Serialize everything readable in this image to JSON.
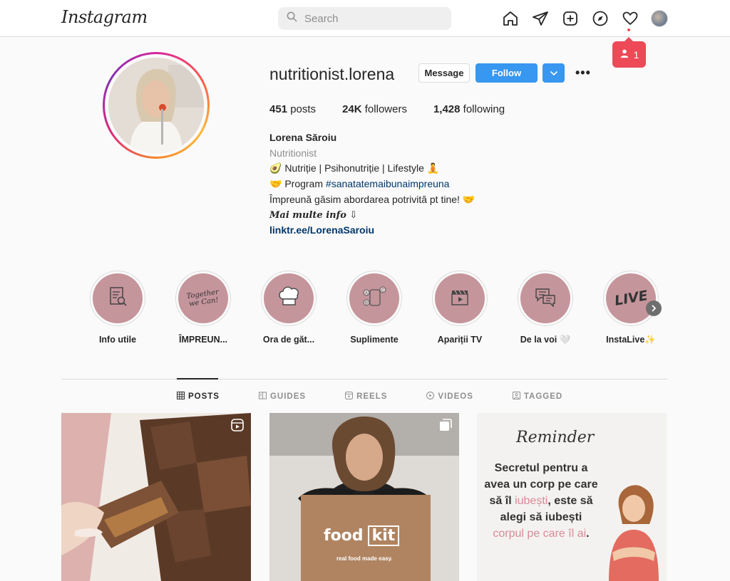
{
  "nav": {
    "logo": "Instagram",
    "search_placeholder": "Search",
    "notifications_count": "1"
  },
  "profile": {
    "username": "nutritionist.lorena",
    "message_label": "Message",
    "follow_label": "Follow",
    "more_label": "•••",
    "stats": {
      "posts_count": "451",
      "posts_label": "posts",
      "followers_count": "24K",
      "followers_label": "followers",
      "following_count": "1,428",
      "following_label": "following"
    },
    "bio": {
      "name": "Lorena Săroiu",
      "category": "Nutritionist",
      "line1": "🥑 Nutriție | Psihonutriție | Lifestyle 🧘",
      "line2_prefix": "🤝 Program ",
      "line2_tag": "#sanatatemaibunaimpreuna",
      "line3": "Împreună găsim abordarea potrivită pt tine! 🤝",
      "line4": "𝑴𝒂𝒊 𝒎𝒖𝒍𝒕𝒆 𝒊𝒏𝒇𝒐 ⇩",
      "link": "linktr.ee/LorenaSaroiu"
    }
  },
  "highlights": [
    {
      "label": "Info utile",
      "icon": "document-search-icon"
    },
    {
      "label": "ÎMPREUN...",
      "icon": "together-we-can-text-icon",
      "icon_text": "Together we Can!"
    },
    {
      "label": "Ora de găt...",
      "icon": "chef-hat-icon"
    },
    {
      "label": "Suplimente",
      "icon": "supplements-jar-icon"
    },
    {
      "label": "Apariții TV",
      "icon": "clapperboard-icon"
    },
    {
      "label": "De la voi 🤍",
      "icon": "chat-bubbles-icon"
    },
    {
      "label": "InstaLive✨",
      "icon": "live-text-icon",
      "icon_text": "LIVE"
    }
  ],
  "tabs": [
    {
      "label": "POSTS",
      "icon": "grid-icon",
      "active": true
    },
    {
      "label": "GUIDES",
      "icon": "guides-icon",
      "active": false
    },
    {
      "label": "REELS",
      "icon": "reels-icon",
      "active": false
    },
    {
      "label": "VIDEOS",
      "icon": "video-icon",
      "active": false
    },
    {
      "label": "TAGGED",
      "icon": "tagged-icon",
      "active": false
    }
  ],
  "posts": {
    "p2_brand": "food",
    "p2_brand_box": "kit",
    "p2_tagline": "real food made easy.",
    "p3_title": "Reminder",
    "p3_t1": "Secretul pentru a avea un corp pe care să îl ",
    "p3_t2": "iubești",
    "p3_t3": ", este să alegi să iubești ",
    "p3_t4": "corpul pe care îl ai",
    "p3_t5": "."
  },
  "colors": {
    "follow_blue": "#3897f0",
    "notif_red": "#ed4956",
    "highlight_pink": "#c5959c"
  }
}
